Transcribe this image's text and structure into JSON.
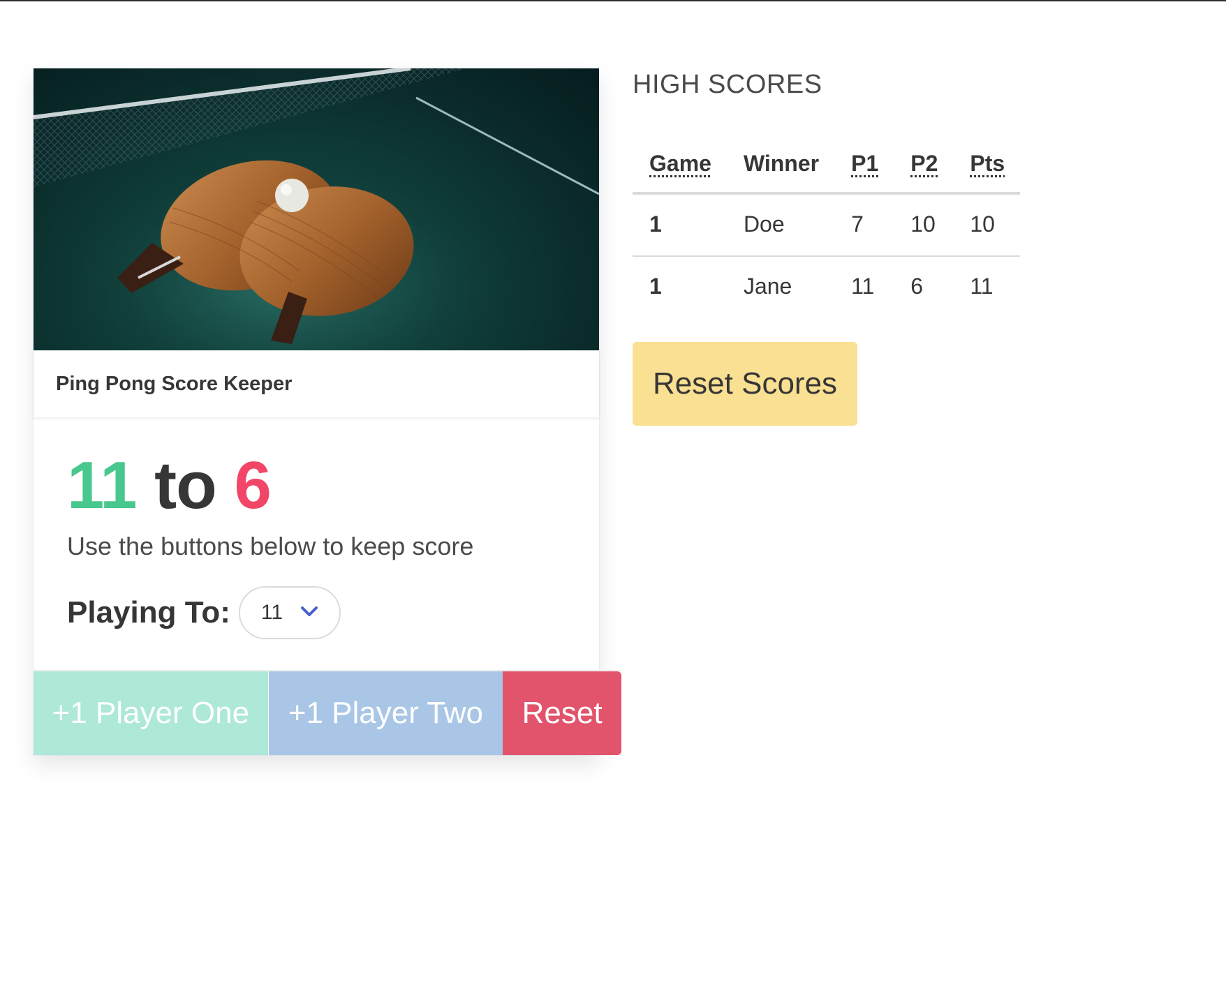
{
  "card": {
    "header_title": "Ping Pong Score Keeper",
    "score": {
      "player_one": "11",
      "separator": "to",
      "player_two": "6"
    },
    "subtitle": "Use the buttons below to keep score",
    "playing_to": {
      "label": "Playing To:",
      "selected_value": "11"
    },
    "buttons": {
      "player_one": "+1 Player One",
      "player_two": "+1 Player Two",
      "reset": "Reset"
    }
  },
  "high_scores": {
    "title": "HIGH SCORES",
    "columns": [
      "Game",
      "Winner",
      "P1",
      "P2",
      "Pts"
    ],
    "rows": [
      [
        "1",
        "Doe",
        "7",
        "10",
        "10"
      ],
      [
        "1",
        "Jane",
        "11",
        "6",
        "11"
      ]
    ],
    "reset_button": "Reset Scores"
  },
  "colors": {
    "player_one": "#48c78e",
    "player_two": "#f14668",
    "btn_player_one": "#ade8d9",
    "btn_player_two": "#a9c6e6",
    "btn_reset": "#e1546b",
    "btn_reset_scores": "#fae092"
  }
}
